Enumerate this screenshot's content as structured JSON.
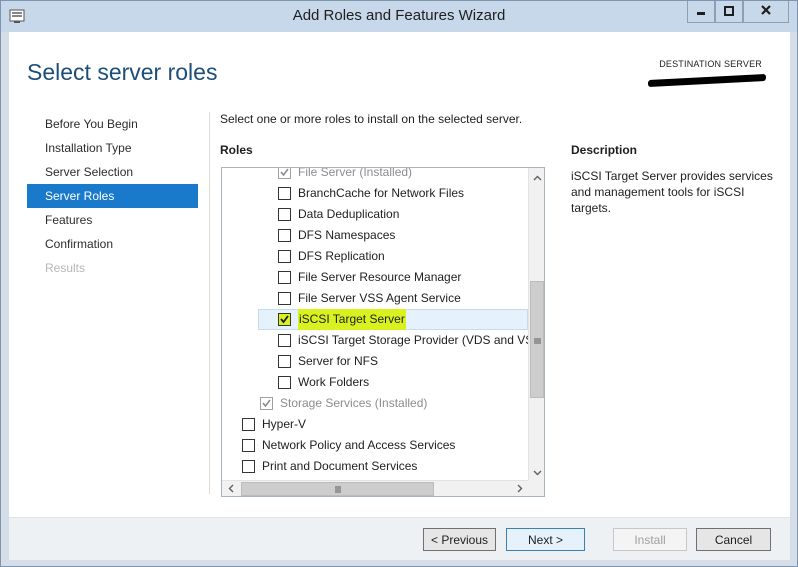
{
  "window": {
    "title": "Add Roles and Features Wizard",
    "icon": "server-manager-icon",
    "minimize_icon": "minimize-icon",
    "maximize_icon": "maximize-icon",
    "close_icon": "close-icon"
  },
  "header": {
    "page_title": "Select server roles",
    "destination_label": "DESTINATION SERVER"
  },
  "nav": {
    "items": [
      {
        "label": "Before You Begin",
        "state": "normal"
      },
      {
        "label": "Installation Type",
        "state": "normal"
      },
      {
        "label": "Server Selection",
        "state": "normal"
      },
      {
        "label": "Server Roles",
        "state": "active"
      },
      {
        "label": "Features",
        "state": "normal"
      },
      {
        "label": "Confirmation",
        "state": "normal"
      },
      {
        "label": "Results",
        "state": "disabled"
      }
    ]
  },
  "main": {
    "instruction": "Select one or more roles to install on the selected server.",
    "roles_heading": "Roles",
    "roles": [
      {
        "label": "File Server (Installed)",
        "checked": true,
        "disabled": true
      },
      {
        "label": "BranchCache for Network Files",
        "checked": false,
        "disabled": false
      },
      {
        "label": "Data Deduplication",
        "checked": false,
        "disabled": false
      },
      {
        "label": "DFS Namespaces",
        "checked": false,
        "disabled": false
      },
      {
        "label": "DFS Replication",
        "checked": false,
        "disabled": false
      },
      {
        "label": "File Server Resource Manager",
        "checked": false,
        "disabled": false
      },
      {
        "label": "File Server VSS Agent Service",
        "checked": false,
        "disabled": false
      },
      {
        "label": "iSCSI Target Server",
        "checked": true,
        "disabled": false,
        "selected": true
      },
      {
        "label": "iSCSI Target Storage Provider (VDS and VSS",
        "checked": false,
        "disabled": false
      },
      {
        "label": "Server for NFS",
        "checked": false,
        "disabled": false
      },
      {
        "label": "Work Folders",
        "checked": false,
        "disabled": false
      },
      {
        "label": "Storage Services (Installed)",
        "checked": true,
        "disabled": true
      },
      {
        "label": "Hyper-V",
        "checked": false,
        "disabled": false
      },
      {
        "label": "Network Policy and Access Services",
        "checked": false,
        "disabled": false
      },
      {
        "label": "Print and Document Services",
        "checked": false,
        "disabled": false
      }
    ],
    "description_heading": "Description",
    "description_text": "iSCSI Target Server provides services and management tools for iSCSI targets."
  },
  "footer": {
    "previous_label": "< Previous",
    "next_label": "Next >",
    "install_label": "Install",
    "cancel_label": "Cancel"
  },
  "colors": {
    "accent": "#1979ca",
    "title_blue": "#1d4e7a",
    "highlight": "#d9f21f"
  }
}
